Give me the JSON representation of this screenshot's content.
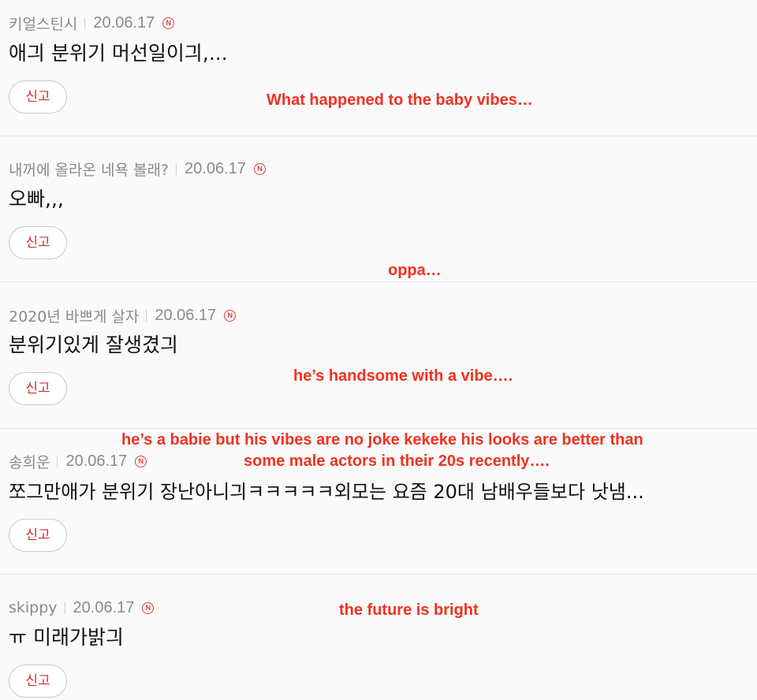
{
  "comments": [
    {
      "author": "키얼스틴시",
      "date": "20.06.17",
      "badge": "N",
      "text": "애긔 분위기 머선일이긔,...",
      "report_label": "신고"
    },
    {
      "author": "내꺼에 올라온 네욕 볼래?",
      "date": "20.06.17",
      "badge": "N",
      "text": "오빠,,,",
      "report_label": "신고"
    },
    {
      "author": "2020년 바쁘게 살자",
      "date": "20.06.17",
      "badge": "N",
      "text": "분위기있게 잘생겼긔",
      "report_label": "신고"
    },
    {
      "author": "송희운",
      "date": "20.06.17",
      "badge": "N",
      "text": "쪼그만애가 분위기 장난아니긔ㅋㅋㅋㅋㅋ외모는 요즘 20대 남배우들보다 낫냄...",
      "report_label": "신고"
    },
    {
      "author": "skippy",
      "date": "20.06.17",
      "badge": "N",
      "text": "ㅠ 미래가밝긔",
      "report_label": "신고"
    }
  ],
  "translations": [
    "What happened to the baby vibes…",
    "oppa…",
    "he’s handsome with a vibe….",
    "he’s a babie but his vibes are no joke kekeke his looks are better than",
    "some male actors in their 20s recently….",
    "the future is bright"
  ],
  "colors": {
    "translation_text": "#f2311f",
    "report_text": "#d33030",
    "badge": "#e03a3a",
    "meta_text": "#8a8a8a",
    "row_background": "#fafafa"
  },
  "icons": {
    "badge": "new-badge-icon"
  }
}
